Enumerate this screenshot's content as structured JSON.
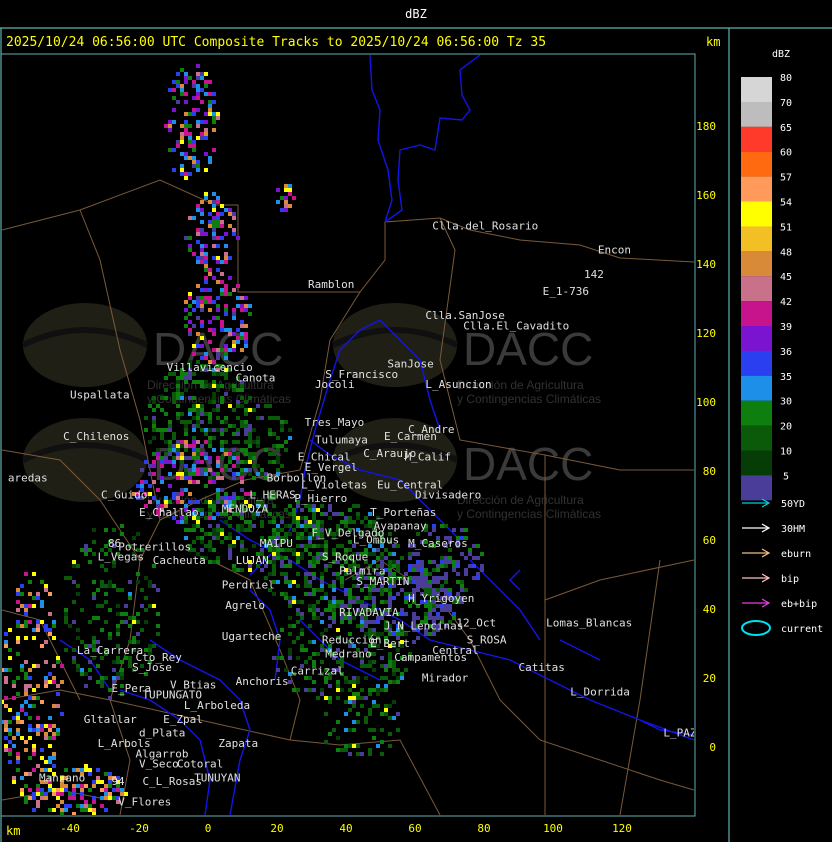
{
  "header": {
    "window_title": "dBZ",
    "plot_title": "2025/10/24 06:56:00 UTC Composite Tracks to 2025/10/24 06:56:00 Tz 35",
    "km_top": "km",
    "km_bottom": "km"
  },
  "axes": {
    "x_ticks": [
      "-40",
      "-20",
      "0",
      "20",
      "40",
      "60",
      "80",
      "100",
      "120"
    ],
    "y_ticks": [
      "180",
      "160",
      "140",
      "120",
      "100",
      "80",
      "60",
      "40",
      "20",
      "0"
    ],
    "x_range": [
      -58,
      140
    ],
    "y_range": [
      -19,
      200
    ]
  },
  "legend": {
    "title": "dBZ",
    "scale": [
      {
        "label": "80",
        "color": "#d6d6d6"
      },
      {
        "label": "70",
        "color": "#bdbdbd"
      },
      {
        "label": "65",
        "color": "#ff3a2a"
      },
      {
        "label": "60",
        "color": "#ff6a10"
      },
      {
        "label": "57",
        "color": "#ff9a5a"
      },
      {
        "label": "54",
        "color": "#ffff00"
      },
      {
        "label": "51",
        "color": "#f2c025"
      },
      {
        "label": "48",
        "color": "#d98a38"
      },
      {
        "label": "45",
        "color": "#c9708a"
      },
      {
        "label": "42",
        "color": "#c8148c"
      },
      {
        "label": "39",
        "color": "#7a14d0"
      },
      {
        "label": "36",
        "color": "#2a40f0"
      },
      {
        "label": "35",
        "color": "#1e8fe8"
      },
      {
        "label": "30",
        "color": "#0e7e0e"
      },
      {
        "label": "20",
        "color": "#0a5a0a"
      },
      {
        "label": "10",
        "color": "#063c06"
      },
      {
        "label": "5",
        "color": "#4a3d9a"
      }
    ],
    "tracks": [
      {
        "label": "50YD",
        "color": "#00d0d0"
      },
      {
        "label": "30HM",
        "color": "#ffffff"
      },
      {
        "label": "eburn",
        "color": "#f0c080"
      },
      {
        "label": "bip",
        "color": "#ffc0c0"
      },
      {
        "label": "eb+bip",
        "color": "#e040e0"
      },
      {
        "label": "current",
        "color": "#00e0f0"
      }
    ]
  },
  "watermark": {
    "name": "DACC",
    "line1": "Dirección de Agricultura",
    "line2": "y Contingencias Climáticas"
  },
  "places": [
    {
      "name": "Clla.del_Rosario",
      "x": 65,
      "y": 150
    },
    {
      "name": "Encon",
      "x": 113,
      "y": 143
    },
    {
      "name": "142",
      "x": 109,
      "y": 136
    },
    {
      "name": "E_1-736",
      "x": 97,
      "y": 131
    },
    {
      "name": "Ramblon",
      "x": 29,
      "y": 133
    },
    {
      "name": "Clla.SanJose",
      "x": 63,
      "y": 124
    },
    {
      "name": "Clla.El_Cavadito",
      "x": 74,
      "y": 121
    },
    {
      "name": "S_Francisco",
      "x": 34,
      "y": 107
    },
    {
      "name": "SanJose",
      "x": 52,
      "y": 110
    },
    {
      "name": "Jocoli",
      "x": 31,
      "y": 104
    },
    {
      "name": "L_Asuncion",
      "x": 63,
      "y": 104
    },
    {
      "name": "Villavicencio",
      "x": -12,
      "y": 109
    },
    {
      "name": "Canota",
      "x": 8,
      "y": 106
    },
    {
      "name": "Uspallata",
      "x": -40,
      "y": 101
    },
    {
      "name": "Tres_Mayo",
      "x": 28,
      "y": 93
    },
    {
      "name": "C_Andre",
      "x": 58,
      "y": 91
    },
    {
      "name": "C_Chilenos",
      "x": -42,
      "y": 89
    },
    {
      "name": "Tulumaya",
      "x": 31,
      "y": 88
    },
    {
      "name": "E_Carmen",
      "x": 51,
      "y": 89
    },
    {
      "name": "C_Araujo",
      "x": 45,
      "y": 84
    },
    {
      "name": "E_Chical",
      "x": 26,
      "y": 83
    },
    {
      "name": "M_Calif",
      "x": 57,
      "y": 83
    },
    {
      "name": "E_Vergel",
      "x": 28,
      "y": 80
    },
    {
      "name": "Borbollon",
      "x": 17,
      "y": 77
    },
    {
      "name": "Eu_Central",
      "x": 49,
      "y": 75
    },
    {
      "name": "L_Violetas",
      "x": 27,
      "y": 75
    },
    {
      "name": "Divisadero",
      "x": 60,
      "y": 72
    },
    {
      "name": "C_Guido",
      "x": -31,
      "y": 72
    },
    {
      "name": "L_HERAS",
      "x": 12,
      "y": 72
    },
    {
      "name": "P_Hierro",
      "x": 25,
      "y": 71
    },
    {
      "name": "E_Challao",
      "x": -20,
      "y": 67
    },
    {
      "name": "MENDOZA",
      "x": 4,
      "y": 68
    },
    {
      "name": "T_Porteñas",
      "x": 47,
      "y": 67
    },
    {
      "name": "Ayapanay",
      "x": 48,
      "y": 63
    },
    {
      "name": "F_V_Delgado",
      "x": 30,
      "y": 61
    },
    {
      "name": "Potrerillos",
      "x": -26,
      "y": 57
    },
    {
      "name": "Cacheuta",
      "x": -16,
      "y": 53
    },
    {
      "name": "MAIPU",
      "x": 15,
      "y": 58
    },
    {
      "name": "L_Ombus",
      "x": 42,
      "y": 59
    },
    {
      "name": "M_Caseros",
      "x": 58,
      "y": 58
    },
    {
      "name": "L_Vegas",
      "x": -32,
      "y": 54
    },
    {
      "name": "S_Roque",
      "x": 33,
      "y": 54
    },
    {
      "name": "LUJAN",
      "x": 8,
      "y": 53
    },
    {
      "name": "Palmira",
      "x": 38,
      "y": 50
    },
    {
      "name": "Perdriel",
      "x": 4,
      "y": 46
    },
    {
      "name": "S_MARTIN",
      "x": 43,
      "y": 47
    },
    {
      "name": "Agrelo",
      "x": 5,
      "y": 40
    },
    {
      "name": "H_Yrigoyen",
      "x": 58,
      "y": 42
    },
    {
      "name": "RIVADAVIA",
      "x": 38,
      "y": 38
    },
    {
      "name": "Lomas_Blancas",
      "x": 98,
      "y": 35
    },
    {
      "name": "J_N_Lencinas",
      "x": 51,
      "y": 34
    },
    {
      "name": "12_Oct",
      "x": 72,
      "y": 35
    },
    {
      "name": "Ugarteche",
      "x": 4,
      "y": 31
    },
    {
      "name": "S_ROSA",
      "x": 75,
      "y": 30
    },
    {
      "name": "Medrano",
      "x": 34,
      "y": 26
    },
    {
      "name": "Reducción",
      "x": 33,
      "y": 30
    },
    {
      "name": "E_Bert",
      "x": 47,
      "y": 29
    },
    {
      "name": "Central",
      "x": 65,
      "y": 27
    },
    {
      "name": "La_Carrera",
      "x": -38,
      "y": 27
    },
    {
      "name": "Cto_Rey",
      "x": -21,
      "y": 25
    },
    {
      "name": "Campamentos",
      "x": 54,
      "y": 25
    },
    {
      "name": "S_Jose",
      "x": -22,
      "y": 22
    },
    {
      "name": "Catitas",
      "x": 90,
      "y": 22
    },
    {
      "name": "Carrizal",
      "x": 24,
      "y": 21
    },
    {
      "name": "Mirador",
      "x": 62,
      "y": 19
    },
    {
      "name": "Anchoris",
      "x": 8,
      "y": 18
    },
    {
      "name": "V_Btias",
      "x": -11,
      "y": 17
    },
    {
      "name": "E_Pera",
      "x": -28,
      "y": 16
    },
    {
      "name": "TUPUNGATO",
      "x": -19,
      "y": 14
    },
    {
      "name": "L_Dorrida",
      "x": 105,
      "y": 15
    },
    {
      "name": "L_Arboleda",
      "x": -7,
      "y": 11
    },
    {
      "name": "Gltallar",
      "x": -36,
      "y": 7
    },
    {
      "name": "E_Zpal",
      "x": -13,
      "y": 7
    },
    {
      "name": "d_Plata",
      "x": -20,
      "y": 3
    },
    {
      "name": "L_Arbols",
      "x": -32,
      "y": 0
    },
    {
      "name": "Zapata",
      "x": 3,
      "y": 0
    },
    {
      "name": "L_PAZ",
      "x": 132,
      "y": 3
    },
    {
      "name": "Algarrob",
      "x": -21,
      "y": -3
    },
    {
      "name": "V_Seco",
      "x": -20,
      "y": -6
    },
    {
      "name": "Cotoral",
      "x": -9,
      "y": -6
    },
    {
      "name": "TUNUYAN",
      "x": -4,
      "y": -10
    },
    {
      "name": "C_L_Rosas",
      "x": -19,
      "y": -11
    },
    {
      "name": "Manzano",
      "x": -49,
      "y": -10
    },
    {
      "name": "V_Flores",
      "x": -26,
      "y": -17
    },
    {
      "name": "aredas",
      "x": -58,
      "y": 77
    },
    {
      "name": "94",
      "x": -28,
      "y": -11
    },
    {
      "name": "86",
      "x": -29,
      "y": 58
    }
  ]
}
